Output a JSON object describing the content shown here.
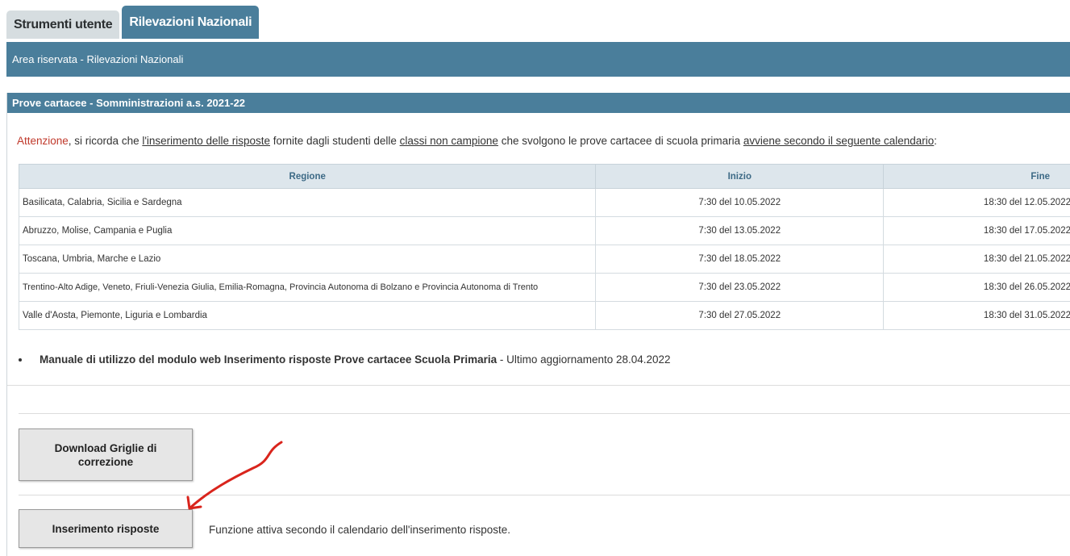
{
  "tabs": [
    {
      "label": "Strumenti utente",
      "active": false
    },
    {
      "label": "Rilevazioni Nazionali",
      "active": true
    }
  ],
  "header": {
    "title": "Area riservata - Rilevazioni Nazionali"
  },
  "panel": {
    "title": "Prove cartacee - Somministrazioni a.s. 2021-22",
    "notice": {
      "attenzione": "Attenzione",
      "t1": ", si ricorda che ",
      "u1": "l'inserimento delle risposte",
      "t2": " fornite dagli studenti delle ",
      "u2": "classi non campione",
      "t3": " che svolgono le prove cartacee di scuola primaria ",
      "u3": "avviene secondo il seguente calendario",
      "t4": ":"
    },
    "table": {
      "headers": [
        "Regione",
        "Inizio",
        "Fine"
      ],
      "rows": [
        [
          "Basilicata, Calabria, Sicilia e Sardegna",
          "7:30 del 10.05.2022",
          "18:30 del 12.05.2022"
        ],
        [
          "Abruzzo, Molise, Campania e Puglia",
          "7:30 del 13.05.2022",
          "18:30 del 17.05.2022"
        ],
        [
          "Toscana, Umbria, Marche e Lazio",
          "7:30 del 18.05.2022",
          "18:30 del 21.05.2022"
        ],
        [
          "Trentino-Alto Adige, Veneto, Friuli-Venezia Giulia, Emilia-Romagna, Provincia Autonoma di Bolzano e Provincia Autonoma di Trento",
          "7:30 del 23.05.2022",
          "18:30 del 26.05.2022"
        ],
        [
          "Valle d'Aosta, Piemonte, Liguria e Lombardia",
          "7:30 del 27.05.2022",
          "18:30 del 31.05.2022"
        ]
      ]
    },
    "manual": {
      "link": "Manuale di utilizzo del modulo web Inserimento risposte Prove cartacee Scuola Primaria",
      "suffix": " - Ultimo aggiornamento 28.04.2022"
    },
    "download_button": {
      "line1": "Download Griglie di",
      "line2": "correzione"
    },
    "insert_button": {
      "label": "Inserimento risposte"
    },
    "insert_note": "Funzione attiva secondo il calendario dell'inserimento risposte."
  },
  "colors": {
    "accent": "#4a7e9b",
    "annotation": "#d9241c"
  }
}
